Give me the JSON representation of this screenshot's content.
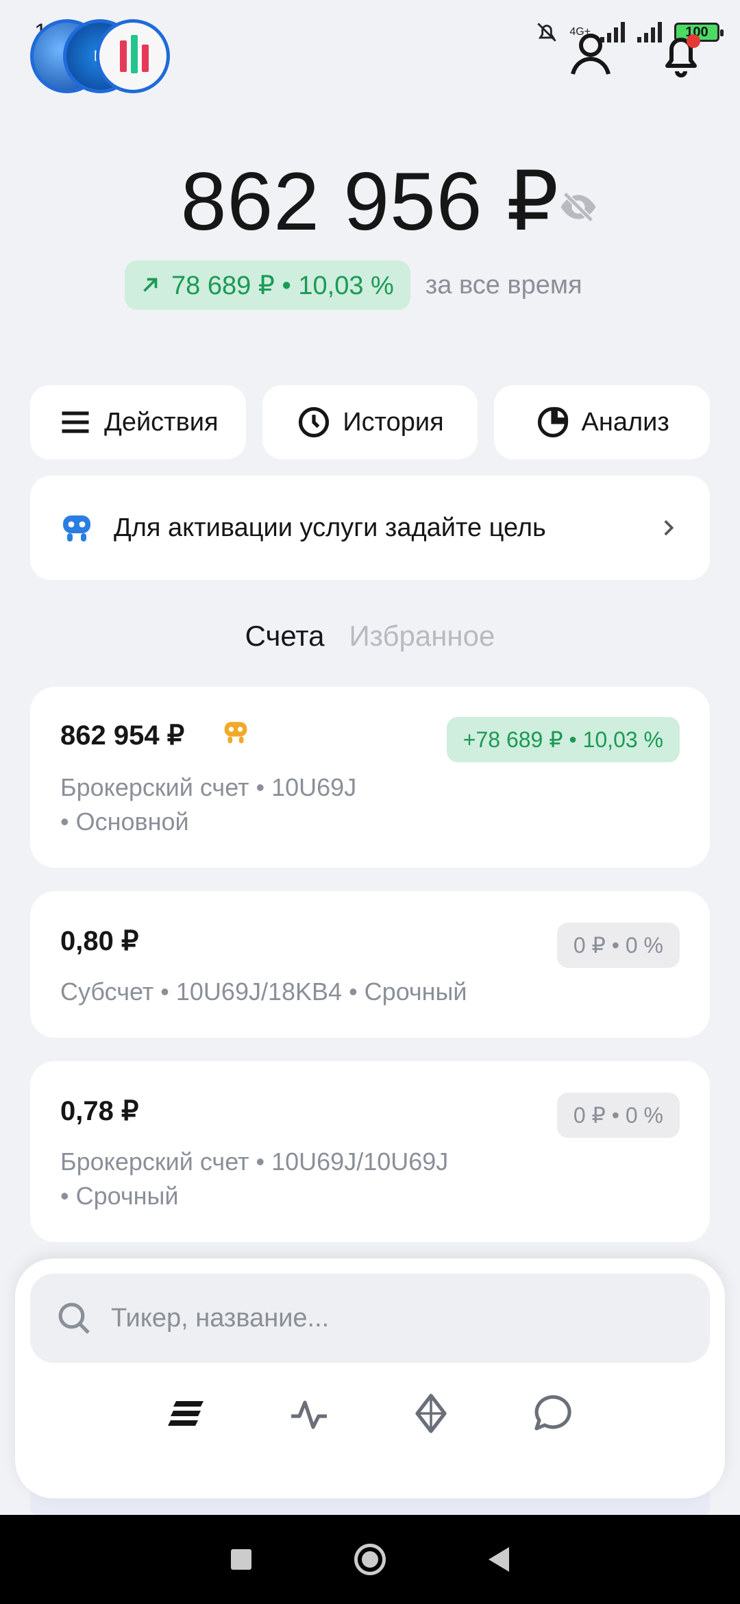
{
  "status_bar": {
    "time": "12:30",
    "network": "4G+",
    "battery": "100"
  },
  "header": {
    "profile_icon": "user-icon",
    "notifications_icon": "bell-icon"
  },
  "balance": {
    "amount": "862 956 ₽",
    "change": "78 689 ₽ • 10,03 %",
    "period": "за все время"
  },
  "actions": [
    {
      "label": "Действия",
      "icon": "menu-icon"
    },
    {
      "label": "История",
      "icon": "clock-icon"
    },
    {
      "label": "Анализ",
      "icon": "pie-chart-icon"
    }
  ],
  "goal_banner": {
    "text": "Для активации услуги задайте цель"
  },
  "tabs": [
    {
      "label": "Счета",
      "active": true
    },
    {
      "label": "Избранное",
      "active": false
    }
  ],
  "accounts": [
    {
      "amount": "862 954 ₽",
      "change": "+78 689 ₽ • 10,03 %",
      "desc_line1": "Брокерский счет • 10U69J",
      "desc_line2": "• Основной"
    },
    {
      "amount": "0,80 ₽",
      "change": "0 ₽ • 0 %",
      "desc_line1": "Субсчет • 10U69J/18KB4 • Срочный"
    },
    {
      "amount": "0,78 ₽",
      "change": "0 ₽ • 0 %",
      "desc_line1": "Брокерский счет • 10U69J/10U69J",
      "desc_line2": "• Срочный"
    }
  ],
  "search": {
    "placeholder": "Тикер, название..."
  },
  "bottom_nav": [
    "portfolio-icon",
    "pulse-icon",
    "crypto-icon",
    "chat-icon"
  ],
  "colors": {
    "accent_green": "#1b9a55",
    "green_bg": "#cfeedd",
    "background": "#f1f2f6",
    "robot_blue": "#2a7de1"
  }
}
